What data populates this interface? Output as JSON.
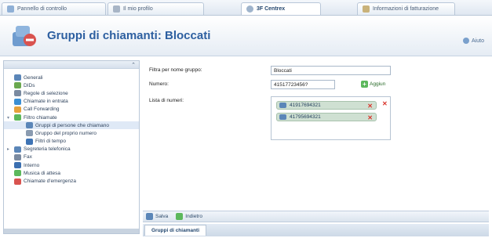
{
  "tabs": [
    {
      "label": "Pannello di controllo",
      "icon": "control-panel-icon"
    },
    {
      "label": "Il mio profilo",
      "icon": "profile-icon"
    },
    {
      "label": "3F Centrex",
      "icon": "centrex-icon"
    },
    {
      "label": "Informazioni di fatturazione",
      "icon": "billing-icon"
    }
  ],
  "header": {
    "title": "Gruppi di chiamanti: Bloccati",
    "help_label": "Aiuto"
  },
  "sidebar": {
    "items": [
      {
        "label": "Generali",
        "icon": "phone-icon",
        "color": "#5b86b8"
      },
      {
        "label": "DIDs",
        "icon": "did-icon",
        "color": "#6aa84f"
      },
      {
        "label": "Regole di selezione",
        "icon": "rules-icon",
        "color": "#7a8aa0"
      },
      {
        "label": "Chiamate in entrata",
        "icon": "incoming-call-icon",
        "color": "#3b8fd4"
      },
      {
        "label": "Call Forwarding",
        "icon": "forwarding-icon",
        "color": "#e6a23c"
      },
      {
        "label": "Filtro chiamate",
        "icon": "call-filter-icon",
        "color": "#5cb85c"
      },
      {
        "label": "Gruppi di persone che chiamano",
        "icon": "caller-groups-icon",
        "color": "#5b86b8"
      },
      {
        "label": "Gruppo del proprio numero",
        "icon": "own-number-group-icon",
        "color": "#8a9bb0"
      },
      {
        "label": "Filtri di tempo",
        "icon": "time-filter-icon",
        "color": "#3f74b5"
      },
      {
        "label": "Segreteria telefonica",
        "icon": "voicemail-icon",
        "color": "#5b86b8"
      },
      {
        "label": "Fax",
        "icon": "fax-icon",
        "color": "#7a8aa0"
      },
      {
        "label": "Interno",
        "icon": "extension-icon",
        "color": "#3b6fb0"
      },
      {
        "label": "Musica di attesa",
        "icon": "music-icon",
        "color": "#5cb85c"
      },
      {
        "label": "Chiamate d'emergenza",
        "icon": "emergency-icon",
        "color": "#d9534f"
      }
    ]
  },
  "form": {
    "filter_label": "Filtra per nome gruppo:",
    "filter_value": "Bloccati",
    "number_label": "Numero:",
    "number_value": "41517723456?",
    "add_label": "Aggiun",
    "list_label": "Lista di numeri:",
    "numbers": [
      "41917694321",
      "41795694321"
    ]
  },
  "toolbar": {
    "save_label": "Salva",
    "back_label": "Indietro"
  },
  "section_tab": "Gruppi di chiamanti"
}
